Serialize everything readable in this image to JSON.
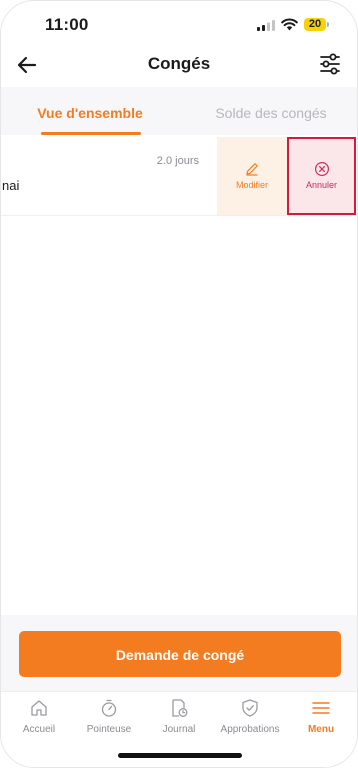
{
  "status_bar": {
    "time": "11:00",
    "battery": "20"
  },
  "header": {
    "title": "Congés",
    "back_icon": "back-arrow-icon",
    "filter_icon": "sliders-icon"
  },
  "tabs": [
    {
      "label": "Vue d'ensemble",
      "active": true
    },
    {
      "label": "Solde des congés",
      "active": false
    }
  ],
  "leave_row": {
    "duration": "2.0 jours",
    "snippet": "nai",
    "actions": [
      {
        "label": "Modifier",
        "icon": "pencil-icon"
      },
      {
        "label": "Annuler",
        "icon": "circle-x-icon"
      }
    ]
  },
  "cta": {
    "label": "Demande de congé"
  },
  "tabbar": [
    {
      "label": "Accueil",
      "icon": "home-icon"
    },
    {
      "label": "Pointeuse",
      "icon": "stopwatch-icon"
    },
    {
      "label": "Journal",
      "icon": "calendar-clock-icon"
    },
    {
      "label": "Approbations",
      "icon": "shield-check-icon"
    },
    {
      "label": "Menu",
      "icon": "menu-icon",
      "active": true
    }
  ],
  "colors": {
    "accent": "#f47c20",
    "cancel": "#cc2d57",
    "highlight_border": "#d21c3e"
  }
}
